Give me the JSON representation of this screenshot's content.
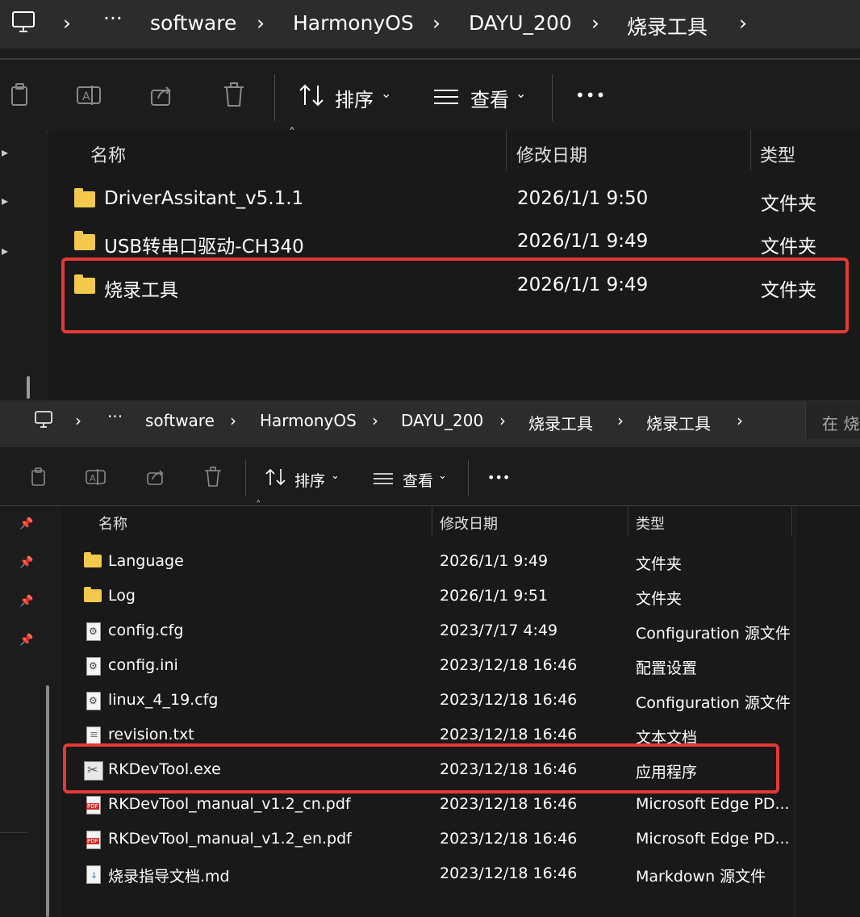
{
  "top": {
    "breadcrumb": [
      "software",
      "HarmonyOS",
      "DAYU_200",
      "烧录工具"
    ],
    "toolbar": {
      "sort_label": "排序",
      "view_label": "查看",
      "more": "•••"
    },
    "columns": {
      "name": "名称",
      "date": "修改日期",
      "type": "类型"
    },
    "rows": [
      {
        "name": "DriverAssitant_v5.1.1",
        "date": "2026/1/1 9:50",
        "type": "文件夹"
      },
      {
        "name": "USB转串口驱动-CH340",
        "date": "2026/1/1 9:49",
        "type": "文件夹"
      },
      {
        "name": "烧录工具",
        "date": "2026/1/1 9:49",
        "type": "文件夹"
      }
    ]
  },
  "bottom": {
    "breadcrumb": [
      "software",
      "HarmonyOS",
      "DAYU_200",
      "烧录工具",
      "烧录工具"
    ],
    "search_placeholder": "在 烧",
    "toolbar": {
      "sort_label": "排序",
      "view_label": "查看",
      "more": "•••"
    },
    "columns": {
      "name": "名称",
      "date": "修改日期",
      "type": "类型"
    },
    "rows": [
      {
        "name": "Language",
        "date": "2026/1/1 9:49",
        "type": "文件夹",
        "icon": "folder-icon"
      },
      {
        "name": "Log",
        "date": "2026/1/1 9:51",
        "type": "文件夹",
        "icon": "folder-icon"
      },
      {
        "name": "config.cfg",
        "date": "2023/7/17 4:49",
        "type": "Configuration 源文件",
        "icon": "config-file-icon"
      },
      {
        "name": "config.ini",
        "date": "2023/12/18 16:46",
        "type": "配置设置",
        "icon": "settings-file-icon"
      },
      {
        "name": "linux_4_19.cfg",
        "date": "2023/12/18 16:46",
        "type": "Configuration 源文件",
        "icon": "config-file-icon"
      },
      {
        "name": "revision.txt",
        "date": "2023/12/18 16:46",
        "type": "文本文档",
        "icon": "text-file-icon"
      },
      {
        "name": "RKDevTool.exe",
        "date": "2023/12/18 16:46",
        "type": "应用程序",
        "icon": "exe-icon"
      },
      {
        "name": "RKDevTool_manual_v1.2_cn.pdf",
        "date": "2023/12/18 16:46",
        "type": "Microsoft Edge PD...",
        "icon": "pdf-icon"
      },
      {
        "name": "RKDevTool_manual_v1.2_en.pdf",
        "date": "2023/12/18 16:46",
        "type": "Microsoft Edge PD...",
        "icon": "pdf-icon"
      },
      {
        "name": "烧录指导文档.md",
        "date": "2023/12/18 16:46",
        "type": "Markdown 源文件",
        "icon": "markdown-file-icon"
      }
    ]
  },
  "colors": {
    "highlight": "#e53935",
    "folder": "#f2c94c",
    "background": "#191919"
  }
}
